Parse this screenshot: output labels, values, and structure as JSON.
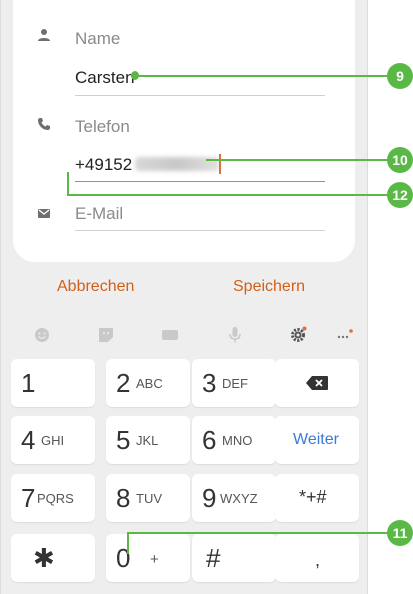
{
  "contact_form": {
    "name_label": "Name",
    "name_value": "Carsten",
    "phone_label": "Telefon",
    "phone_value": "+49152",
    "email_label": "E-Mail"
  },
  "actions": {
    "cancel": "Abbrechen",
    "save": "Speichern"
  },
  "keyboard_toolbar": [
    "emoji-icon",
    "sticker-icon",
    "gif-icon",
    "microphone-icon",
    "settings-icon",
    "more-icon"
  ],
  "keypad": {
    "rows": [
      [
        {
          "num": "1",
          "letters": ""
        },
        {
          "num": "2",
          "letters": "ABC"
        },
        {
          "num": "3",
          "letters": "DEF"
        },
        {
          "num": "",
          "letters": ""
        }
      ],
      [
        {
          "num": "4",
          "letters": "GHI"
        },
        {
          "num": "5",
          "letters": "JKL"
        },
        {
          "num": "6",
          "letters": "MNO"
        },
        {
          "num": "",
          "letters": ""
        }
      ],
      [
        {
          "num": "7",
          "letters": "PQRS"
        },
        {
          "num": "8",
          "letters": "TUV"
        },
        {
          "num": "9",
          "letters": "WXYZ"
        },
        {
          "num": "",
          "letters": ""
        }
      ],
      [
        {
          "num": "✱",
          "letters": ""
        },
        {
          "num": "0",
          "letters": "+"
        },
        {
          "num": "#",
          "letters": ""
        },
        {
          "num": "",
          "letters": ""
        }
      ]
    ],
    "weiter": "Weiter",
    "special": "*+#",
    "comma": ","
  },
  "callouts": [
    "9",
    "10",
    "12",
    "11"
  ],
  "colors": {
    "accent": "#d2601a",
    "callout": "#5ab946",
    "weiter": "#3a7bd5"
  }
}
